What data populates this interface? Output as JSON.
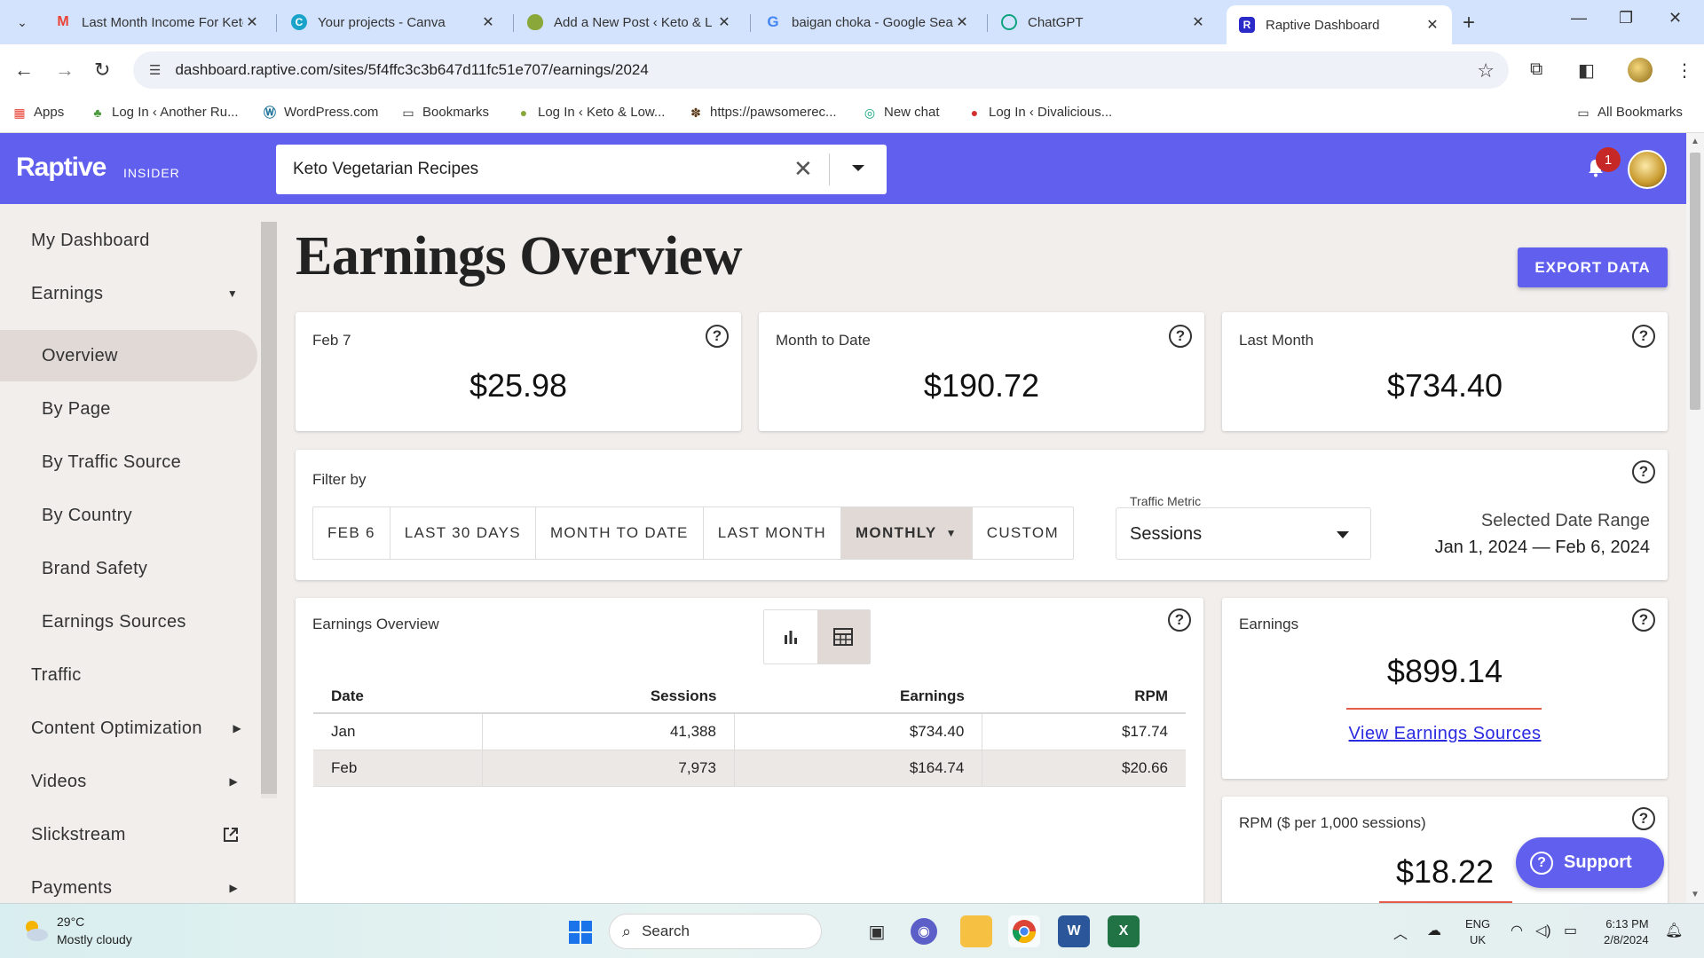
{
  "browser": {
    "tabs": [
      {
        "title": "Last Month Income For Keto",
        "icon": "gmail-icon",
        "color": "#ea4335"
      },
      {
        "title": "Your projects - Canva",
        "icon": "canva-icon",
        "color": "#1aa3c9"
      },
      {
        "title": "Add a New Post ‹ Keto & L",
        "icon": "avocado-icon",
        "color": "#8aa83a"
      },
      {
        "title": "baigan choka - Google Sea",
        "icon": "google-icon",
        "color": "#4285f4"
      },
      {
        "title": "ChatGPT",
        "icon": "chatgpt-icon",
        "color": "#10a37f"
      },
      {
        "title": "Raptive Dashboard",
        "icon": "raptive-icon",
        "color": "#6160ee"
      }
    ],
    "url": "dashboard.raptive.com/sites/5f4ffc3c3b647d11fc51e707/earnings/2024",
    "bookmarks": [
      "Apps",
      "Log In ‹ Another Ru...",
      "WordPress.com",
      "Bookmarks",
      "Log In ‹ Keto & Low...",
      "https://pawsomerec...",
      "New chat",
      "Log In ‹ Divalicious..."
    ],
    "all_bookmarks": "All Bookmarks"
  },
  "header": {
    "logo": "Raptive",
    "logo_sub": "INSIDER",
    "site_name": "Keto Vegetarian Recipes",
    "notification_count": "1",
    "brand_color": "#6160ee"
  },
  "sidebar": {
    "items": [
      {
        "label": "My Dashboard"
      },
      {
        "label": "Earnings"
      },
      {
        "label": "Overview"
      },
      {
        "label": "By Page"
      },
      {
        "label": "By Traffic Source"
      },
      {
        "label": "By Country"
      },
      {
        "label": "Brand Safety"
      },
      {
        "label": "Earnings Sources"
      },
      {
        "label": "Traffic"
      },
      {
        "label": "Content Optimization"
      },
      {
        "label": "Videos"
      },
      {
        "label": "Slickstream"
      },
      {
        "label": "Payments"
      }
    ]
  },
  "main": {
    "title": "Earnings Overview",
    "export_label": "EXPORT DATA",
    "summary_cards": [
      {
        "label": "Feb 7",
        "value": "$25.98"
      },
      {
        "label": "Month to Date",
        "value": "$190.72"
      },
      {
        "label": "Last Month",
        "value": "$734.40"
      }
    ],
    "filter": {
      "label": "Filter by",
      "buttons": [
        "FEB 6",
        "LAST 30 DAYS",
        "MONTH TO DATE",
        "LAST MONTH",
        "MONTHLY",
        "CUSTOM"
      ],
      "metric_label": "Traffic Metric",
      "metric_value": "Sessions",
      "range_label": "Selected Date Range",
      "range_value": "Jan 1, 2024 — Feb 6, 2024"
    },
    "table_card": {
      "title": "Earnings Overview",
      "columns": [
        "Date",
        "Sessions",
        "Earnings",
        "RPM"
      ],
      "rows": [
        [
          "Jan",
          "41,388",
          "$734.40",
          "$17.74"
        ],
        [
          "Feb",
          "7,973",
          "$164.74",
          "$20.66"
        ]
      ]
    },
    "earnings_card": {
      "label": "Earnings",
      "value": "$899.14",
      "link": "View Earnings Sources"
    },
    "rpm_card": {
      "label": "RPM ($ per 1,000 sessions)",
      "value": "$18.22"
    },
    "support_label": "Support"
  },
  "taskbar": {
    "temperature": "29°C",
    "weather": "Mostly cloudy",
    "search_placeholder": "Search",
    "lang_1": "ENG",
    "lang_2": "UK",
    "time": "6:13 PM",
    "date": "2/8/2024"
  }
}
